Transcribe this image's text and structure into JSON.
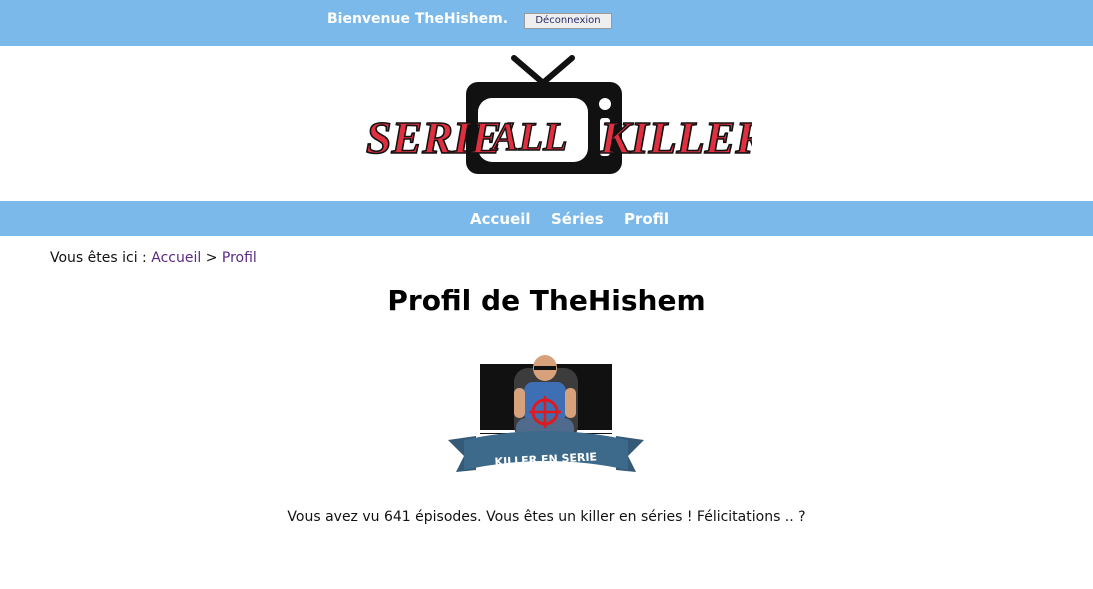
{
  "topbar": {
    "welcome": "Bienvenue TheHishem.",
    "logout_label": "Déconnexion"
  },
  "logo": {
    "text_left": "SERIE'",
    "text_middle": "ALL",
    "text_right": "KILLER"
  },
  "nav": {
    "items": [
      {
        "label": "Accueil"
      },
      {
        "label": "Séries"
      },
      {
        "label": "Profil"
      }
    ]
  },
  "breadcrumb": {
    "prefix": "Vous êtes ici :",
    "home": "Accueil",
    "separator": ">",
    "current": "Profil"
  },
  "page_title": "Profil de TheHishem",
  "badge": {
    "label": "KILLER EN SERIE"
  },
  "message": "Vous avez vu 641 épisodes. Vous êtes un killer en séries ! Félicitations .. ?",
  "colors": {
    "bar": "#7ab9ea",
    "link": "#5a2a82",
    "logo_red": "#e03040",
    "badge_ribbon": "#3d6a8a"
  }
}
